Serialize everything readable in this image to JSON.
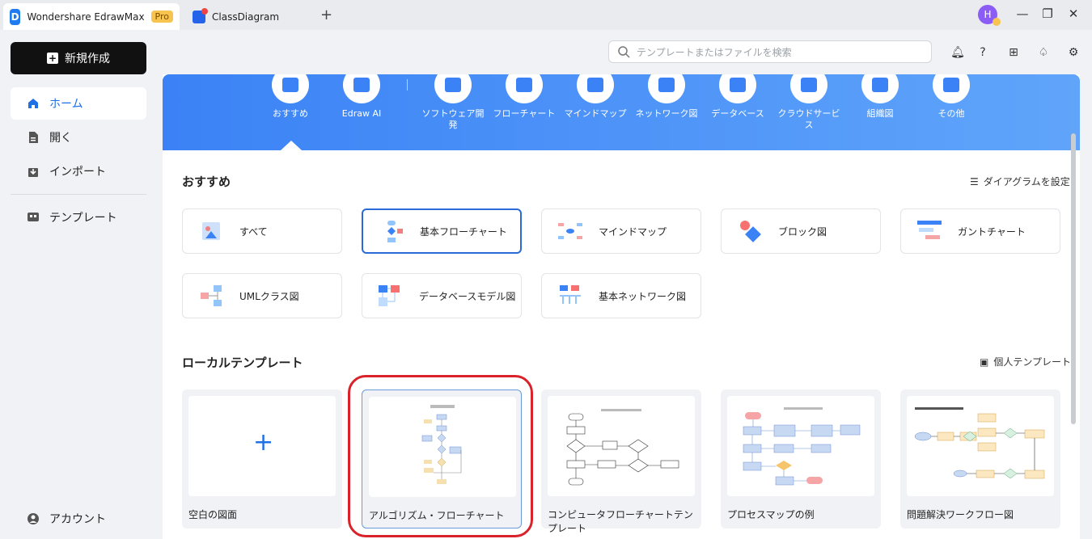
{
  "titlebar": {
    "app_tab": "Wondershare EdrawMax",
    "pro_badge": "Pro",
    "doc_tab": "ClassDiagram",
    "new_tab_icon": "plus-icon",
    "avatar_letter": "H"
  },
  "sidebar": {
    "new_button": "新規作成",
    "items": [
      {
        "label": "ホーム",
        "icon": "home-icon",
        "active": true
      },
      {
        "label": "開く",
        "icon": "file-icon"
      },
      {
        "label": "インポート",
        "icon": "import-icon"
      },
      {
        "label": "テンプレート",
        "icon": "template-icon"
      }
    ],
    "account": "アカウント"
  },
  "search": {
    "placeholder": "テンプレートまたはファイルを検索"
  },
  "categories": [
    "おすすめ",
    "Edraw AI",
    "ソフトウェア開発",
    "フローチャート",
    "マインドマップ",
    "ネットワーク図",
    "データベース",
    "クラウドサービス",
    "組織図",
    "その他"
  ],
  "recommended": {
    "title": "おすすめ",
    "settings_link": "ダイアグラムを設定",
    "cards": [
      "すべて",
      "基本フローチャート",
      "マインドマップ",
      "ブロック図",
      "ガントチャート",
      "UMLクラス図",
      "データベースモデル図",
      "基本ネットワーク図"
    ]
  },
  "local": {
    "title": "ローカルテンプレート",
    "personal_link": "個人テンプレート",
    "templates": [
      "空白の図面",
      "アルゴリズム・フローチャート",
      "コンピュータフローチャートテンプレート",
      "プロセスマップの例",
      "問題解決ワークフロー図"
    ]
  },
  "colors": {
    "accent": "#1f6fe5",
    "banner": "#4a8ff5",
    "highlight": "#d9222a"
  }
}
